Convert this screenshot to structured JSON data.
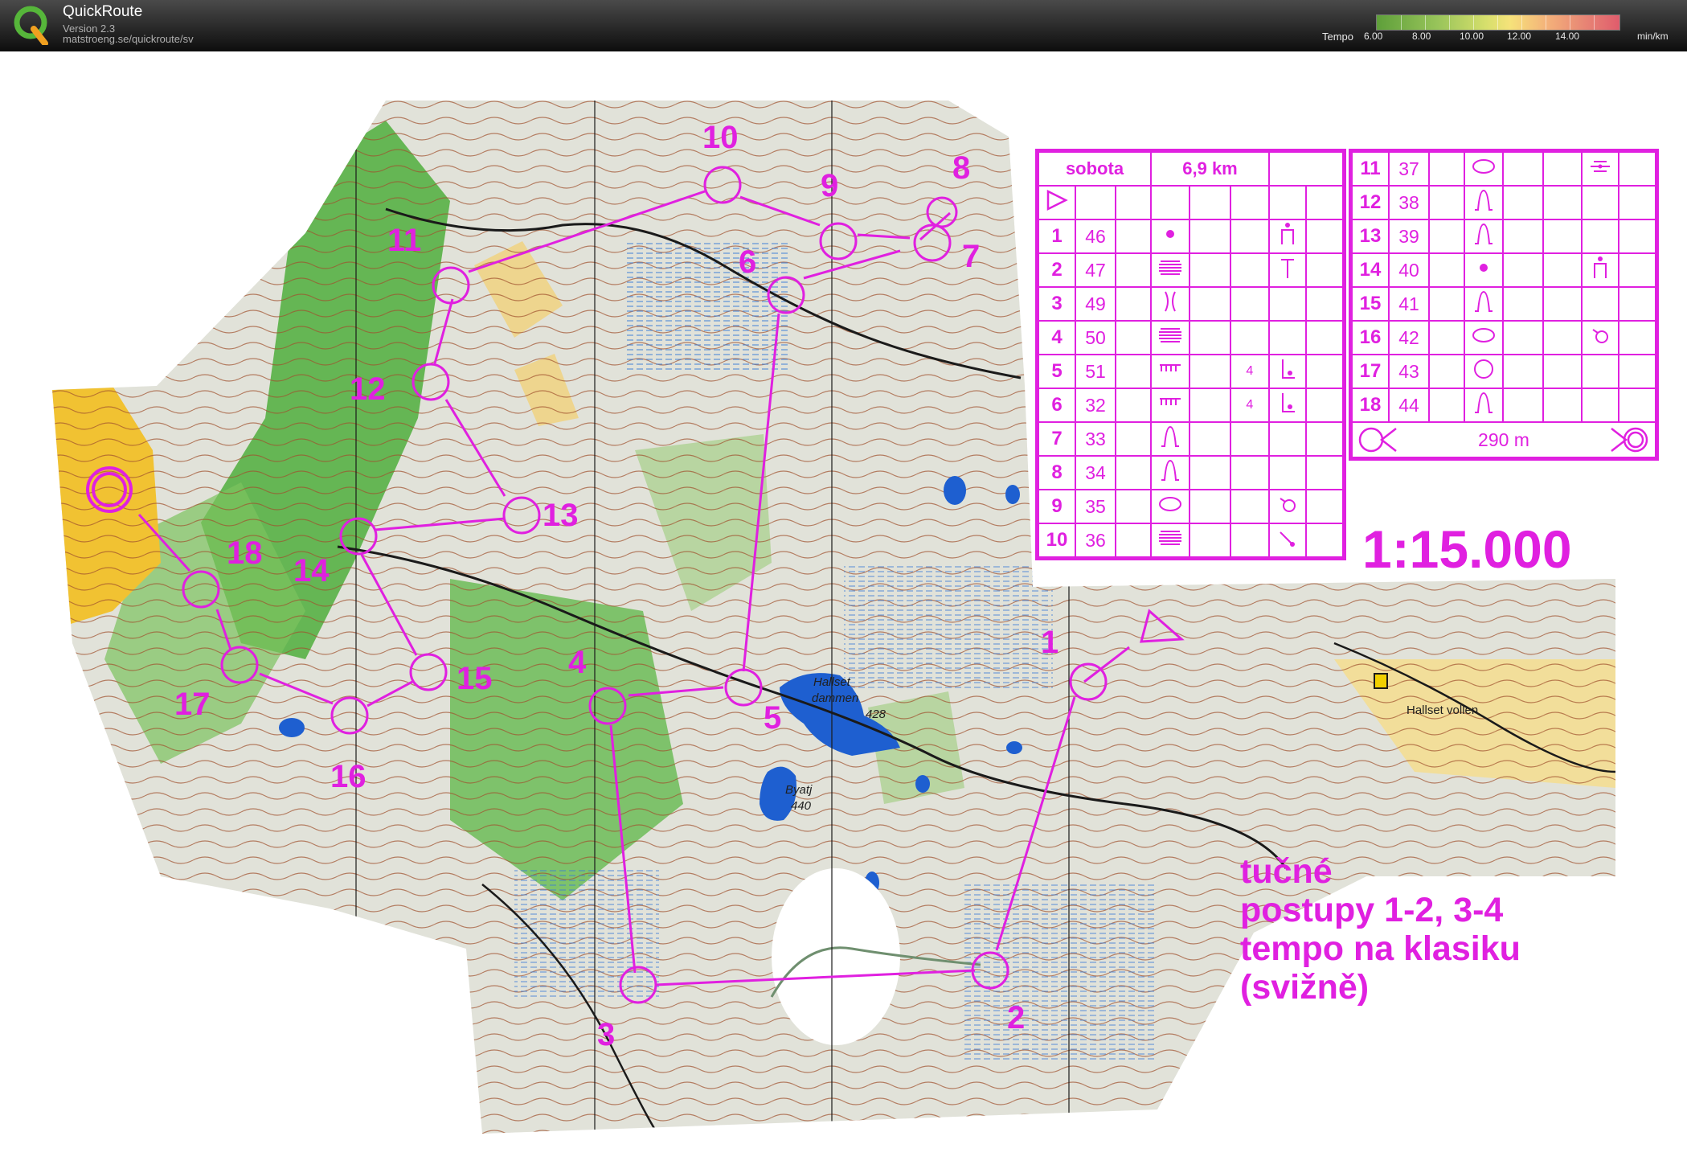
{
  "app": {
    "title": "QuickRoute",
    "version": "Version 2.3",
    "url": "matstroeng.se/quickroute/sv",
    "logo_icon": "quickroute-q-logo"
  },
  "tempo": {
    "label": "Tempo",
    "ticks": [
      "6.00",
      "8.00",
      "10.00",
      "12.00",
      "14.00"
    ],
    "unit": "min/km"
  },
  "map": {
    "scale": "1:15.000",
    "note": [
      "tučné",
      "postupy 1-2, 3-4",
      "tempo na klasiku",
      "(svižně)"
    ],
    "labels": [
      "Hallset",
      "dammen",
      "428",
      "Byatj",
      "440",
      "Hallset vollen"
    ],
    "colors": {
      "course": "#e020e0",
      "water": "#1e5fd0",
      "green": "#4fae3c",
      "open": "#f1c232"
    },
    "controls": [
      "1",
      "2",
      "3",
      "4",
      "5",
      "6",
      "7",
      "8",
      "9",
      "10",
      "11",
      "12",
      "13",
      "14",
      "15",
      "16",
      "17",
      "18"
    ]
  },
  "description": {
    "header": {
      "event": "sobota",
      "length": "6,9 km"
    },
    "left_rows": [
      {
        "num": "1",
        "code": "46",
        "feature": "dot",
        "dim": "",
        "pos": "tower"
      },
      {
        "num": "2",
        "code": "47",
        "feature": "marsh",
        "dim": "",
        "pos": "post"
      },
      {
        "num": "3",
        "code": "49",
        "feature": "gully",
        "dim": "",
        "pos": ""
      },
      {
        "num": "4",
        "code": "50",
        "feature": "marsh",
        "dim": "",
        "pos": ""
      },
      {
        "num": "5",
        "code": "51",
        "feature": "cliff",
        "dim": "4",
        "pos": "corner"
      },
      {
        "num": "6",
        "code": "32",
        "feature": "cliff",
        "dim": "4",
        "pos": "corner"
      },
      {
        "num": "7",
        "code": "33",
        "feature": "knoll",
        "dim": "",
        "pos": ""
      },
      {
        "num": "8",
        "code": "34",
        "feature": "knoll",
        "dim": "",
        "pos": ""
      },
      {
        "num": "9",
        "code": "35",
        "feature": "depression",
        "dim": "",
        "pos": "foot"
      },
      {
        "num": "10",
        "code": "36",
        "feature": "marsh",
        "dim": "",
        "pos": "slope"
      }
    ],
    "right_rows": [
      {
        "num": "11",
        "code": "37",
        "feature": "depression",
        "dim": "",
        "pos": "between"
      },
      {
        "num": "12",
        "code": "38",
        "feature": "knoll",
        "dim": "",
        "pos": ""
      },
      {
        "num": "13",
        "code": "39",
        "feature": "knoll",
        "dim": "",
        "pos": ""
      },
      {
        "num": "14",
        "code": "40",
        "feature": "dot",
        "dim": "",
        "pos": "tower"
      },
      {
        "num": "15",
        "code": "41",
        "feature": "knoll",
        "dim": "",
        "pos": ""
      },
      {
        "num": "16",
        "code": "42",
        "feature": "depression",
        "dim": "",
        "pos": "foot"
      },
      {
        "num": "17",
        "code": "43",
        "feature": "circle",
        "dim": "",
        "pos": ""
      },
      {
        "num": "18",
        "code": "44",
        "feature": "knoll",
        "dim": "",
        "pos": ""
      }
    ],
    "finish_distance": "290 m"
  }
}
